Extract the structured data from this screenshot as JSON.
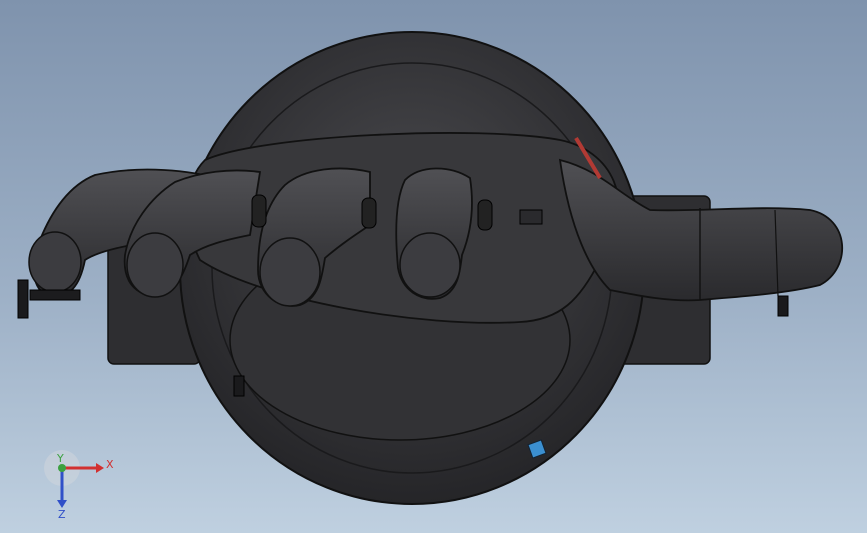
{
  "scene": {
    "background_top": "#7f93ad",
    "background_bottom": "#bfd0e0",
    "model_color": "#3a3a3d",
    "model_shade": "#2c2c2f",
    "edge_color": "#111111",
    "accent_red": "#b23a34",
    "accent_blue": "#3b8fd0"
  },
  "triad": {
    "x_label": "X",
    "y_label": "Y",
    "z_label": "Z",
    "x_color": "#d23030",
    "y_color": "#3ca040",
    "z_color": "#3050c8"
  }
}
